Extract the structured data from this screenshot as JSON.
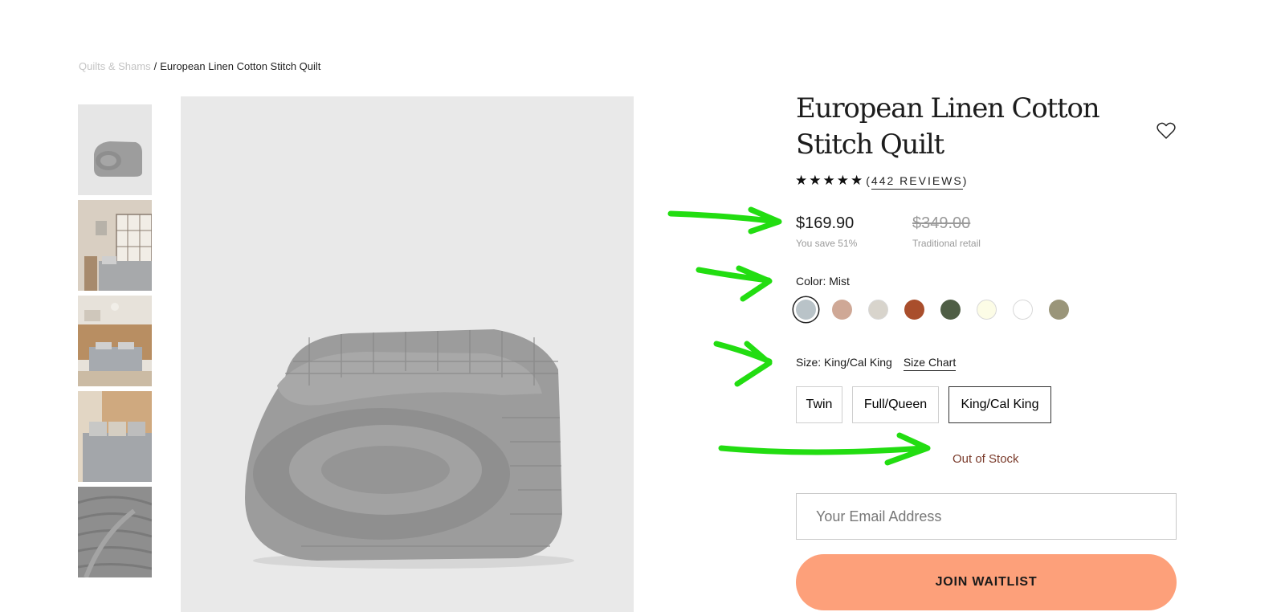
{
  "breadcrumb": {
    "parent": "Quilts & Shams",
    "separator": "/",
    "current": "European Linen Cotton Stitch Quilt"
  },
  "product": {
    "title": "European Linen Cotton Stitch Quilt",
    "rating": {
      "stars": 5,
      "reviews_label": "442 REVIEWS"
    },
    "price": {
      "current": "$169.90",
      "savings": "You save 51%",
      "original": "$349.00",
      "original_label": "Traditional retail"
    }
  },
  "color": {
    "label": "Color: Mist",
    "swatches": [
      {
        "name": "mist",
        "hex": "#b9c3c8",
        "selected": true
      },
      {
        "name": "blush",
        "hex": "#cfa896"
      },
      {
        "name": "sand",
        "hex": "#d8d4cc"
      },
      {
        "name": "rust",
        "hex": "#a94e2c"
      },
      {
        "name": "olive",
        "hex": "#4f5e45"
      },
      {
        "name": "cream",
        "hex": "#fcfce6"
      },
      {
        "name": "white",
        "hex": "#ffffff"
      },
      {
        "name": "sage",
        "hex": "#9a9579"
      }
    ]
  },
  "size": {
    "label": "Size: King/Cal King",
    "chart_link": "Size Chart",
    "options": [
      {
        "label": "Twin"
      },
      {
        "label": "Full/Queen"
      },
      {
        "label": "King/Cal King",
        "selected": true
      }
    ]
  },
  "stock_status": "Out of Stock",
  "waitlist": {
    "email_placeholder": "Your Email Address",
    "button_label": "JOIN WAITLIST"
  },
  "colors": {
    "accent_button": "#fda07a",
    "stock_text": "#7a3a2a",
    "annotation_arrow": "#22dd11"
  },
  "icons": [
    "heart-icon",
    "star-icon"
  ]
}
